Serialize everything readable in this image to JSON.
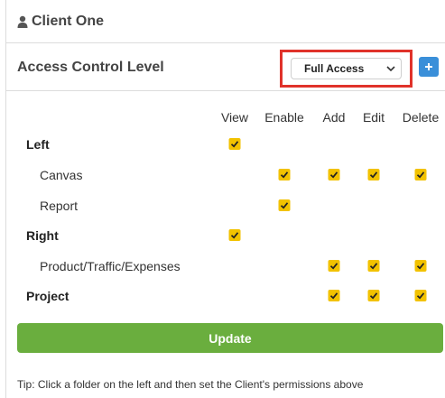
{
  "client": {
    "name": "Client One",
    "icon": "user-icon"
  },
  "acl": {
    "title": "Access Control Level",
    "selected_level": "Full Access",
    "add_icon": "plus-icon",
    "highlight_color": "#e0322a",
    "add_button_color": "#3a8fd9"
  },
  "permissions": {
    "columns": [
      "View",
      "Enable",
      "Add",
      "Edit",
      "Delete"
    ],
    "rows": [
      {
        "label": "Left",
        "level": "parent",
        "checked": [
          "View"
        ]
      },
      {
        "label": "Canvas",
        "level": "child",
        "checked": [
          "Enable",
          "Add",
          "Edit",
          "Delete"
        ]
      },
      {
        "label": "Report",
        "level": "child",
        "checked": [
          "Enable"
        ]
      },
      {
        "label": "Right",
        "level": "parent",
        "checked": [
          "View"
        ]
      },
      {
        "label": "Product/Traffic/Expenses",
        "level": "child",
        "checked": [
          "Add",
          "Edit",
          "Delete"
        ]
      },
      {
        "label": "Project",
        "level": "parent",
        "checked": [
          "Add",
          "Edit",
          "Delete"
        ]
      }
    ],
    "checkbox_color": "#f2c200"
  },
  "update_button": {
    "label": "Update",
    "color": "#6aae3e"
  },
  "tip": "Tip: Click a folder on the left and then set the Client's permissions above"
}
